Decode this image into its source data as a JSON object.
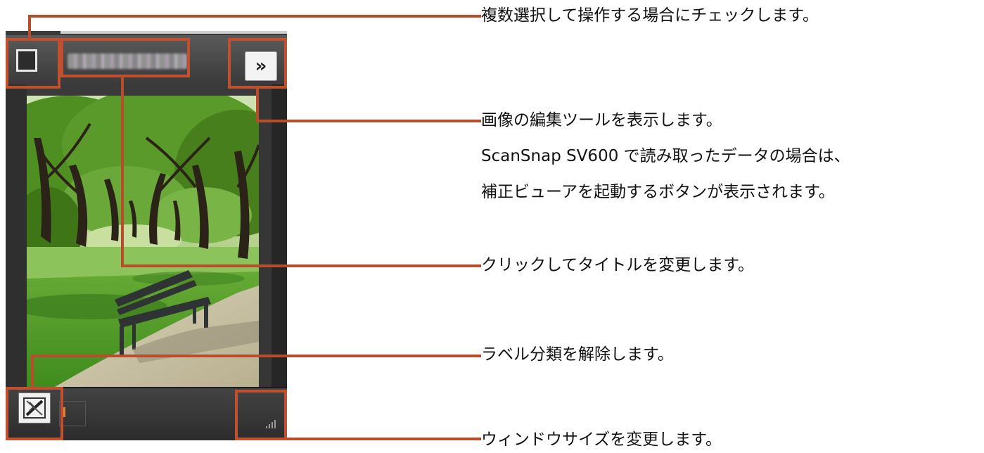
{
  "card": {
    "edit_button_glyph": "»",
    "label_icon": "label-remove-icon",
    "resize_icon": "resize-grip-icon",
    "accent": "#c0502f"
  },
  "callouts": {
    "checkbox": "複数選択して操作する場合にチェックします。",
    "edit_tools": [
      "画像の編集ツールを表示します。",
      "ScanSnap SV600 で読み取ったデータの場合は、",
      "補正ビューアを起動するボタンが表示されます。"
    ],
    "title": "クリックしてタイトルを変更します。",
    "label": "ラベル分類を解除します。",
    "resize": "ウィンドウサイズを変更します。"
  }
}
